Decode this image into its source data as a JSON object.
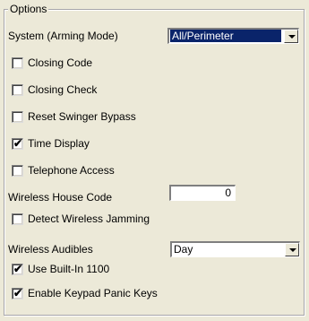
{
  "group": {
    "title": "Options"
  },
  "system_arming_mode": {
    "label": "System (Arming Mode)",
    "value": "All/Perimeter"
  },
  "checkboxes": {
    "closing_code": {
      "label": "Closing Code",
      "checked": false
    },
    "closing_check": {
      "label": "Closing Check",
      "checked": false
    },
    "reset_swinger_bypass": {
      "label": "Reset Swinger Bypass",
      "checked": false
    },
    "time_display": {
      "label": "Time Display",
      "checked": true
    },
    "telephone_access": {
      "label": "Telephone Access",
      "checked": false
    },
    "detect_wireless_jamming": {
      "label": "Detect Wireless Jamming",
      "checked": false
    },
    "use_builtin_1100": {
      "label": "Use Built-In 1100",
      "checked": true
    },
    "enable_keypad_panic_keys": {
      "label": "Enable Keypad Panic Keys",
      "checked": true
    }
  },
  "wireless_house_code": {
    "label": "Wireless House Code",
    "value": "0"
  },
  "wireless_audibles": {
    "label": "Wireless Audibles",
    "value": "Day"
  },
  "check_mark": "✔"
}
